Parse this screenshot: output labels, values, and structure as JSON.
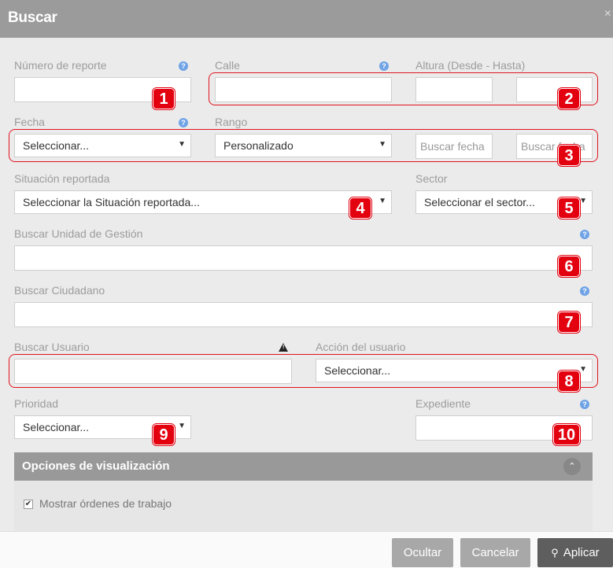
{
  "dialog": {
    "title": "Buscar",
    "close": "×"
  },
  "fields": {
    "numero_reporte": {
      "label": "Número de reporte",
      "help": "?"
    },
    "calle": {
      "label": "Calle",
      "help": "?"
    },
    "altura": {
      "label": "Altura (Desde - Hasta)"
    },
    "fecha": {
      "label": "Fecha",
      "help": "?",
      "value": "Seleccionar..."
    },
    "rango": {
      "label": "Rango",
      "value": "Personalizado"
    },
    "buscar_fecha_desde": {
      "placeholder": "Buscar fecha"
    },
    "buscar_fecha_hasta": {
      "placeholder": "Buscar fecha"
    },
    "situacion": {
      "label": "Situación reportada",
      "value": "Seleccionar la Situación reportada..."
    },
    "sector": {
      "label": "Sector",
      "value": "Seleccionar el sector..."
    },
    "unidad_gestion": {
      "label": "Buscar Unidad de Gestión",
      "help": "?"
    },
    "ciudadano": {
      "label": "Buscar Ciudadano",
      "help": "?"
    },
    "usuario": {
      "label": "Buscar Usuario",
      "warn": "!"
    },
    "accion_usuario": {
      "label": "Acción del usuario",
      "value": "Seleccionar..."
    },
    "prioridad": {
      "label": "Prioridad",
      "value": "Seleccionar..."
    },
    "expediente": {
      "label": "Expediente",
      "help": "?"
    }
  },
  "arrow_glyph": "▼",
  "badges": [
    "1",
    "2",
    "3",
    "4",
    "5",
    "6",
    "7",
    "8",
    "9",
    "10"
  ],
  "display_options": {
    "title": "Opciones de visualización",
    "toggle": "⌃",
    "show_work_orders": {
      "label": "Mostrar órdenes de trabajo",
      "checked": true,
      "mark": "✔"
    }
  },
  "footer": {
    "hide_label": "Ocultar",
    "cancel_label": "Cancelar",
    "apply_label": "Aplicar",
    "apply_icon": "⚲"
  },
  "colors": {
    "annotation_red": "#e3000f",
    "help_blue": "#6fa3e6",
    "header_gray": "#9b9b9b"
  }
}
